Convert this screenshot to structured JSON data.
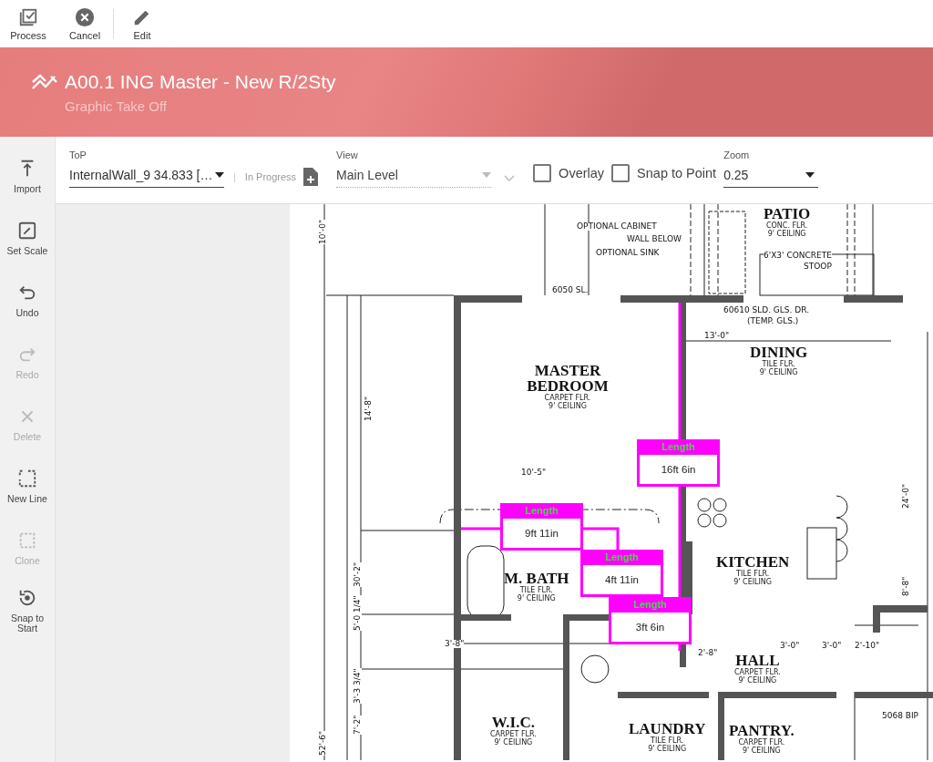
{
  "toolbar": [
    {
      "label": "Process",
      "kind": "process",
      "disabled": false
    },
    {
      "label": "Cancel",
      "kind": "cancel",
      "disabled": false
    },
    {
      "label": "Edit",
      "kind": "edit",
      "disabled": false
    }
  ],
  "header": {
    "title": "A00.1 ING Master - New R/2Sty",
    "subtitle": "Graphic Take Off"
  },
  "sidebar": {
    "items": [
      {
        "label": "Import",
        "kind": "import",
        "disabled": false
      },
      {
        "label": "Set Scale",
        "kind": "scale",
        "disabled": false
      },
      {
        "label": "Undo",
        "kind": "undo",
        "disabled": false
      },
      {
        "label": "Redo",
        "kind": "redo",
        "disabled": true
      },
      {
        "label": "Delete",
        "kind": "delete",
        "disabled": true
      },
      {
        "label": "New Line",
        "kind": "newline",
        "disabled": false
      },
      {
        "label": "Clone",
        "kind": "clone",
        "disabled": true
      },
      {
        "label": "Snap to Start",
        "kind": "snap",
        "disabled": false
      }
    ]
  },
  "controls": {
    "top": {
      "label": "ToP",
      "value": "InternalWall_9 34.833 […"
    },
    "separator": "|",
    "status": "In Progress",
    "view": {
      "label": "View",
      "value": "Main Level",
      "disabled": true
    },
    "checkboxes": [
      {
        "label": "Overlay",
        "checked": false
      },
      {
        "label": "Snap to Point",
        "checked": false
      }
    ],
    "zoom": {
      "label": "Zoom",
      "value": "0.25"
    }
  },
  "plan": {
    "rooms": [
      {
        "name": "PATIO",
        "floor": "CONC. FLR.",
        "ceiling": "9' CEILING"
      },
      {
        "name": "MASTER BEDROOM",
        "floor": "CARPET FLR.",
        "ceiling": "9' CEILING"
      },
      {
        "name": "DINING",
        "floor": "TILE FLR.",
        "ceiling": "9' CEILING"
      },
      {
        "name": "KITCHEN",
        "floor": "TILE FLR.",
        "ceiling": "9' CEILING"
      },
      {
        "name": "M. BATH",
        "floor": "TILE FLR.",
        "ceiling": "9' CEILING"
      },
      {
        "name": "HALL",
        "floor": "CARPET FLR.",
        "ceiling": "9' CEILING"
      },
      {
        "name": "W.I.C.",
        "floor": "CARPET FLR.",
        "ceiling": "9' CEILING"
      },
      {
        "name": "LAUNDRY",
        "floor": "TILE FLR.",
        "ceiling": "9' CEILING"
      },
      {
        "name": "PANTRY.",
        "floor": "CARPET FLR.",
        "ceiling": "9' CEILING"
      }
    ],
    "notes": [
      {
        "text": "OPTIONAL CABINET",
        "kind": "h"
      },
      {
        "text": "WALL BELOW",
        "kind": "h"
      },
      {
        "text": "OPTIONAL SINK",
        "kind": "h"
      },
      {
        "text": "6'X3' CONCRETE",
        "kind": "h"
      },
      {
        "text": "STOOP",
        "kind": "h"
      },
      {
        "text": "6050 SL.",
        "kind": "h"
      },
      {
        "text": "60610 SLD. GLS. DR.",
        "kind": "h"
      },
      {
        "text": "(TEMP. GLS.)",
        "kind": "h"
      },
      {
        "text": "13'-0\"",
        "kind": "h"
      },
      {
        "text": "10'-5\"",
        "kind": "h"
      },
      {
        "text": "10'-0\"",
        "kind": "v"
      },
      {
        "text": "14'-8\"",
        "kind": "v"
      },
      {
        "text": "30'-2\"",
        "kind": "v"
      },
      {
        "text": "5'-0 1/4\"",
        "kind": "v"
      },
      {
        "text": "3'-3 3/4\"",
        "kind": "v"
      },
      {
        "text": "7'-2\"",
        "kind": "v"
      },
      {
        "text": "52'-6\"",
        "kind": "v"
      },
      {
        "text": "24'-0\"",
        "kind": "v"
      },
      {
        "text": "8'-8\"",
        "kind": "v"
      },
      {
        "text": "3'-8\"",
        "kind": "h"
      },
      {
        "text": "2'-8\"",
        "kind": "h"
      },
      {
        "text": "3'-0\"",
        "kind": "h"
      },
      {
        "text": "3'-0\"",
        "kind": "h"
      },
      {
        "text": "2'-10\"",
        "kind": "h"
      },
      {
        "text": "5068 BIP",
        "kind": "h"
      }
    ],
    "measurements": [
      {
        "label": "Length",
        "value": "16ft 6in"
      },
      {
        "label": "Length",
        "value": "9ft 11in"
      },
      {
        "label": "Length",
        "value": "4ft 11in"
      },
      {
        "label": "Length",
        "value": "3ft 6in"
      }
    ]
  }
}
